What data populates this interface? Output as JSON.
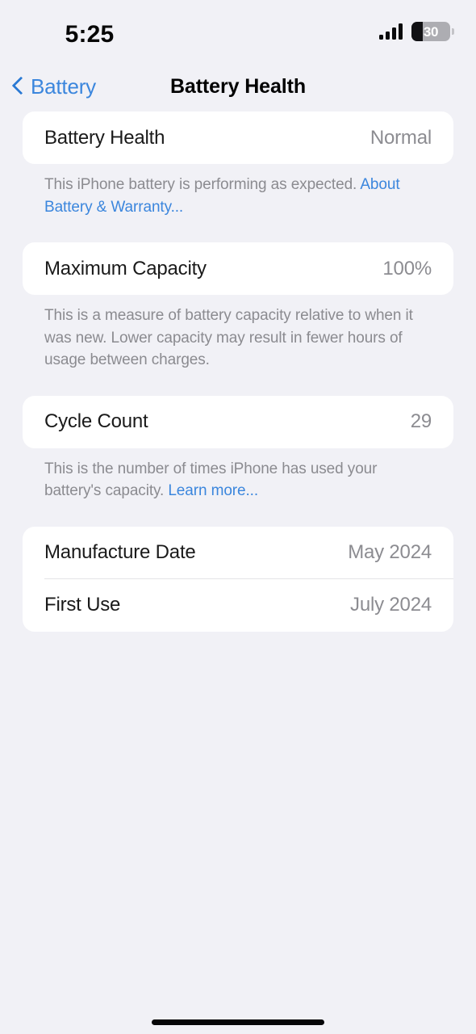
{
  "status_bar": {
    "time": "5:25",
    "signal_icon": "cellular-signal-icon",
    "battery_percent": "30",
    "battery_level_ratio": 0.3
  },
  "nav": {
    "back_label": "Battery",
    "back_icon": "chevron-left-icon",
    "title": "Battery Health"
  },
  "sections": {
    "battery_health": {
      "row": {
        "label": "Battery Health",
        "value": "Normal"
      },
      "footnote_text": "This iPhone battery is performing as expected. ",
      "footnote_link": "About Battery & Warranty..."
    },
    "maximum_capacity": {
      "row": {
        "label": "Maximum Capacity",
        "value": "100%"
      },
      "footnote_text": "This is a measure of battery capacity relative to when it was new. Lower capacity may result in fewer hours of usage between charges."
    },
    "cycle_count": {
      "row": {
        "label": "Cycle Count",
        "value": "29"
      },
      "footnote_text": "This is the number of times iPhone has used your battery's capacity. ",
      "footnote_link": "Learn more..."
    },
    "dates": {
      "manufacture": {
        "label": "Manufacture Date",
        "value": "May 2024"
      },
      "first_use": {
        "label": "First Use",
        "value": "July 2024"
      }
    }
  },
  "colors": {
    "background": "#f1f1f6",
    "card": "#ffffff",
    "accent_blue": "#3b86dd",
    "value_gray": "#8c8c91",
    "footnote_gray": "#8b8b90"
  }
}
